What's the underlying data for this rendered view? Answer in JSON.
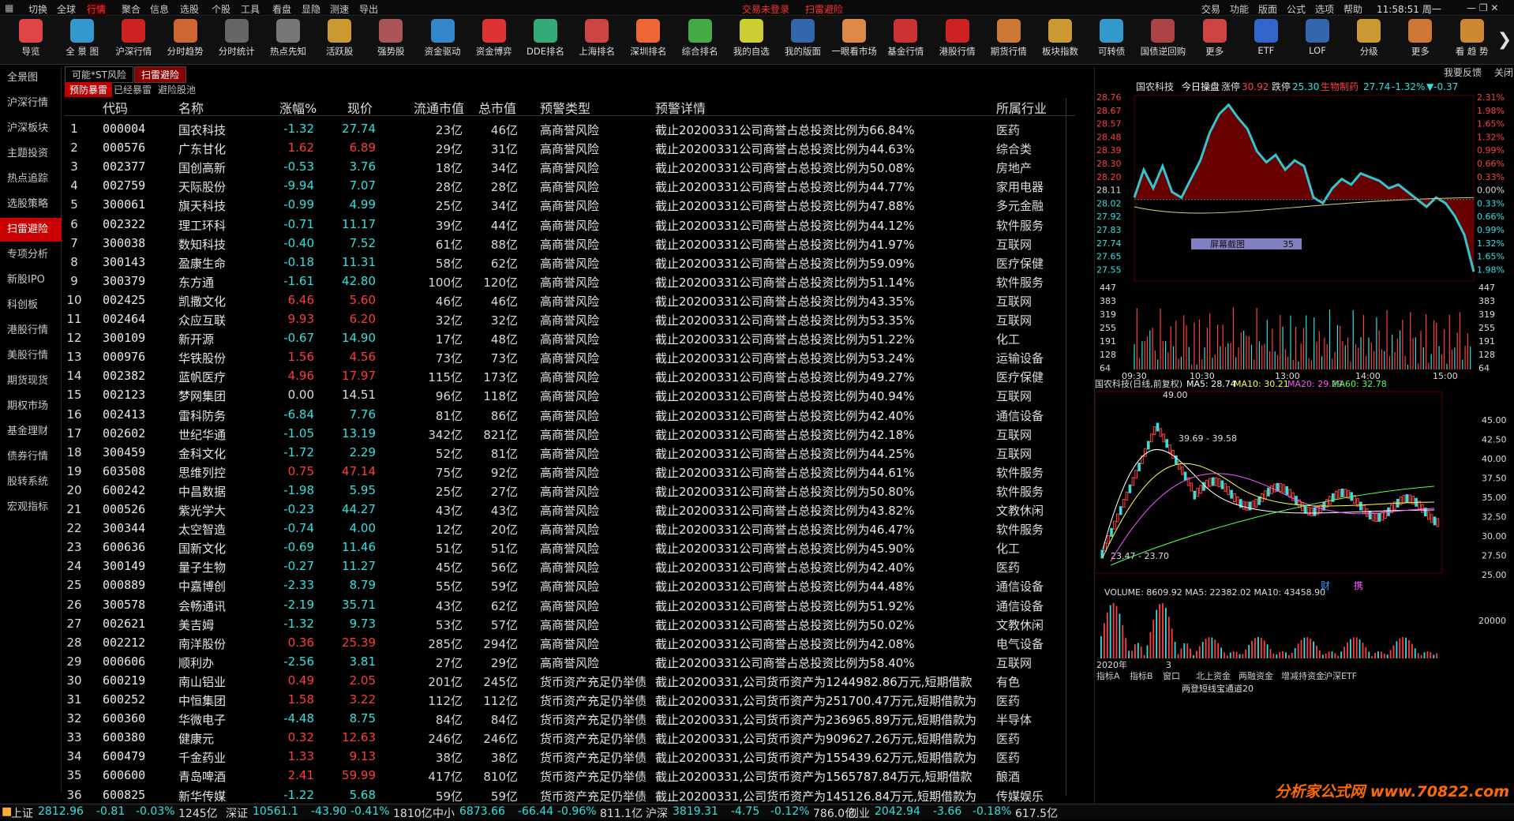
{
  "menubar": {
    "items": [
      "切换",
      "全球",
      "行情",
      "聚合",
      "信息",
      "选股",
      "个股",
      "工具",
      "看盘",
      "显隐",
      "测速",
      "导出"
    ],
    "active": "行情",
    "alerts": [
      "交易未登录",
      "扫雷避险"
    ],
    "right_items": [
      "交易",
      "功能",
      "版面",
      "公式",
      "选项",
      "帮助"
    ],
    "clock": "11:58:51 周一"
  },
  "toolbar": {
    "buttons": [
      "导览",
      "全 景 图",
      "沪深行情",
      "分时趋势",
      "分时统计",
      "热点先知",
      "活跃股",
      "强势股",
      "资金驱动",
      "资金博弈",
      "DDE排名",
      "上海排名",
      "深圳排名",
      "综合排名",
      "我的自选",
      "我的版面",
      "一眼看市场",
      "基金行情",
      "港股行情",
      "期货行情",
      "板块指数",
      "可转债",
      "国债逆回购",
      "更多",
      "ETF",
      "LOF",
      "分级",
      "更多",
      "看 趋 势"
    ]
  },
  "sidebar": {
    "items": [
      "全景图",
      "沪深行情",
      "沪深板块",
      "主题投资",
      "热点追踪",
      "选股策略",
      "扫雷避险",
      "专项分析",
      "新股IPO",
      "科创板",
      "港股行情",
      "美股行情",
      "期货现货",
      "期权市场",
      "基金理财",
      "债券行情",
      "股转系统",
      "宏观指标"
    ],
    "active": "扫雷避险"
  },
  "tabs": {
    "top": [
      "可能*ST风险",
      "扫雷避险"
    ],
    "top_active": "扫雷避险",
    "sub": [
      "预防暴雷",
      "已经暴雷",
      "避险股池"
    ],
    "sub_active": "预防暴雷"
  },
  "table": {
    "headers": [
      "代码",
      "名称",
      "涨幅%",
      "现价",
      "流通市值",
      "总市值",
      "预警类型",
      "预警详情",
      "所属行业"
    ],
    "rows": [
      [
        "1",
        "000004",
        "国农科技",
        "-1.32",
        "27.74",
        "23亿",
        "46亿",
        "高商誉风险",
        "截止20200331公司商誉占总投资比例为66.84%",
        "医药"
      ],
      [
        "2",
        "000576",
        "广东甘化",
        "1.62",
        "6.89",
        "29亿",
        "31亿",
        "高商誉风险",
        "截止20200331公司商誉占总投资比例为44.63%",
        "综合类"
      ],
      [
        "3",
        "002377",
        "国创高新",
        "-0.53",
        "3.76",
        "18亿",
        "34亿",
        "高商誉风险",
        "截止20200331公司商誉占总投资比例为50.08%",
        "房地产"
      ],
      [
        "4",
        "002759",
        "天际股份",
        "-9.94",
        "7.07",
        "28亿",
        "28亿",
        "高商誉风险",
        "截止20200331公司商誉占总投资比例为44.77%",
        "家用电器"
      ],
      [
        "5",
        "300061",
        "旗天科技",
        "-0.99",
        "4.99",
        "25亿",
        "34亿",
        "高商誉风险",
        "截止20200331公司商誉占总投资比例为47.88%",
        "多元金融"
      ],
      [
        "6",
        "002322",
        "理工环科",
        "-0.71",
        "11.17",
        "39亿",
        "44亿",
        "高商誉风险",
        "截止20200331公司商誉占总投资比例为44.12%",
        "软件服务"
      ],
      [
        "7",
        "300038",
        "数知科技",
        "-0.40",
        "7.52",
        "61亿",
        "88亿",
        "高商誉风险",
        "截止20200331公司商誉占总投资比例为41.97%",
        "互联网"
      ],
      [
        "8",
        "300143",
        "盈康生命",
        "-0.18",
        "11.31",
        "58亿",
        "62亿",
        "高商誉风险",
        "截止20200331公司商誉占总投资比例为59.09%",
        "医疗保健"
      ],
      [
        "9",
        "300379",
        "东方通",
        "-1.61",
        "42.80",
        "100亿",
        "120亿",
        "高商誉风险",
        "截止20200331公司商誉占总投资比例为51.14%",
        "软件服务"
      ],
      [
        "10",
        "002425",
        "凯撒文化",
        "6.46",
        "5.60",
        "46亿",
        "46亿",
        "高商誉风险",
        "截止20200331公司商誉占总投资比例为43.35%",
        "互联网"
      ],
      [
        "11",
        "002464",
        "众应互联",
        "9.93",
        "6.20",
        "32亿",
        "32亿",
        "高商誉风险",
        "截止20200331公司商誉占总投资比例为53.35%",
        "互联网"
      ],
      [
        "12",
        "300109",
        "新开源",
        "-0.67",
        "14.90",
        "17亿",
        "48亿",
        "高商誉风险",
        "截止20200331公司商誉占总投资比例为51.22%",
        "化工"
      ],
      [
        "13",
        "000976",
        "华铁股份",
        "1.56",
        "4.56",
        "73亿",
        "73亿",
        "高商誉风险",
        "截止20200331公司商誉占总投资比例为53.24%",
        "运输设备"
      ],
      [
        "14",
        "002382",
        "蓝帆医疗",
        "4.96",
        "17.97",
        "115亿",
        "173亿",
        "高商誉风险",
        "截止20200331公司商誉占总投资比例为49.27%",
        "医疗保健"
      ],
      [
        "15",
        "002123",
        "梦网集团",
        "0.00",
        "14.51",
        "96亿",
        "118亿",
        "高商誉风险",
        "截止20200331公司商誉占总投资比例为40.94%",
        "互联网"
      ],
      [
        "16",
        "002413",
        "雷科防务",
        "-6.84",
        "7.76",
        "81亿",
        "86亿",
        "高商誉风险",
        "截止20200331公司商誉占总投资比例为42.40%",
        "通信设备"
      ],
      [
        "17",
        "002602",
        "世纪华通",
        "-1.05",
        "13.19",
        "342亿",
        "821亿",
        "高商誉风险",
        "截止20200331公司商誉占总投资比例为42.18%",
        "互联网"
      ],
      [
        "18",
        "300459",
        "金科文化",
        "-1.72",
        "2.29",
        "52亿",
        "81亿",
        "高商誉风险",
        "截止20200331公司商誉占总投资比例为44.25%",
        "互联网"
      ],
      [
        "19",
        "603508",
        "思维列控",
        "0.75",
        "47.14",
        "75亿",
        "92亿",
        "高商誉风险",
        "截止20200331公司商誉占总投资比例为44.61%",
        "软件服务"
      ],
      [
        "20",
        "600242",
        "中昌数据",
        "-1.98",
        "5.95",
        "25亿",
        "27亿",
        "高商誉风险",
        "截止20200331公司商誉占总投资比例为50.80%",
        "软件服务"
      ],
      [
        "21",
        "000526",
        "紫光学大",
        "-0.23",
        "44.27",
        "43亿",
        "43亿",
        "高商誉风险",
        "截止20200331公司商誉占总投资比例为43.82%",
        "文教休闲"
      ],
      [
        "22",
        "300344",
        "太空智造",
        "-0.74",
        "4.00",
        "12亿",
        "20亿",
        "高商誉风险",
        "截止20200331公司商誉占总投资比例为46.47%",
        "软件服务"
      ],
      [
        "23",
        "600636",
        "国新文化",
        "-0.69",
        "11.46",
        "51亿",
        "51亿",
        "高商誉风险",
        "截止20200331公司商誉占总投资比例为45.90%",
        "化工"
      ],
      [
        "24",
        "300149",
        "量子生物",
        "-0.27",
        "11.27",
        "45亿",
        "56亿",
        "高商誉风险",
        "截止20200331公司商誉占总投资比例为42.40%",
        "医药"
      ],
      [
        "25",
        "000889",
        "中嘉博创",
        "-2.33",
        "8.79",
        "55亿",
        "59亿",
        "高商誉风险",
        "截止20200331公司商誉占总投资比例为44.48%",
        "通信设备"
      ],
      [
        "26",
        "300578",
        "会畅通讯",
        "-2.19",
        "35.71",
        "43亿",
        "62亿",
        "高商誉风险",
        "截止20200331公司商誉占总投资比例为51.92%",
        "通信设备"
      ],
      [
        "27",
        "002621",
        "美吉姆",
        "-1.32",
        "9.73",
        "53亿",
        "57亿",
        "高商誉风险",
        "截止20200331公司商誉占总投资比例为50.02%",
        "文教休闲"
      ],
      [
        "28",
        "002212",
        "南洋股份",
        "0.36",
        "25.39",
        "285亿",
        "294亿",
        "高商誉风险",
        "截止20200331公司商誉占总投资比例为42.08%",
        "电气设备"
      ],
      [
        "29",
        "000606",
        "顺利办",
        "-2.56",
        "3.81",
        "27亿",
        "29亿",
        "高商誉风险",
        "截止20200331公司商誉占总投资比例为58.40%",
        "互联网"
      ],
      [
        "30",
        "600219",
        "南山铝业",
        "0.49",
        "2.05",
        "201亿",
        "245亿",
        "货币资产充足仍举债",
        "截止20200331,公司货币资产为1244982.86万元,短期借款",
        "有色"
      ],
      [
        "31",
        "600252",
        "中恒集团",
        "1.58",
        "3.22",
        "112亿",
        "112亿",
        "货币资产充足仍举债",
        "截止20200331,公司货币资产为251700.47万元,短期借款为",
        "医药"
      ],
      [
        "32",
        "600360",
        "华微电子",
        "-4.48",
        "8.75",
        "84亿",
        "84亿",
        "货币资产充足仍举债",
        "截止20200331,公司货币资产为236965.89万元,短期借款为",
        "半导体"
      ],
      [
        "33",
        "600380",
        "健康元",
        "0.32",
        "12.63",
        "246亿",
        "246亿",
        "货币资产充足仍举债",
        "截止20200331,公司货币资产为909627.26万元,短期借款为",
        "医药"
      ],
      [
        "34",
        "600479",
        "千金药业",
        "1.33",
        "9.13",
        "38亿",
        "38亿",
        "货币资产充足仍举债",
        "截止20200331,公司货币资产为155439.62万元,短期借款为",
        "医药"
      ],
      [
        "35",
        "600600",
        "青岛啤酒",
        "2.41",
        "59.99",
        "417亿",
        "810亿",
        "货币资产充足仍举债",
        "截止20200331,公司货币资产为1565787.84万元,短期借款",
        "酿酒"
      ],
      [
        "36",
        "600825",
        "新华传媒",
        "-1.22",
        "5.68",
        "59亿",
        "59亿",
        "货币资产充足仍举债",
        "截止20200331,公司货币资产为145126.84万元,短期借款为",
        "传媒娱乐"
      ]
    ]
  },
  "right_panel": {
    "header_right": [
      "我要反馈",
      "关闭"
    ],
    "stock_name": "国农科技",
    "intraday_label": "今日操盘",
    "limit_up_label": "涨停",
    "limit_up": "30.92",
    "limit_down_label": "跌停",
    "limit_down": "25.30",
    "cycle_label": "生物制药",
    "last": "27.74",
    "pct": "-1.32%",
    "chg": "▼-0.37",
    "price_ticks": [
      "28.76",
      "28.67",
      "28.57",
      "28.48",
      "28.39",
      "28.30",
      "28.20",
      "28.11",
      "28.02",
      "27.92",
      "27.83",
      "27.74",
      "27.65",
      "27.55"
    ],
    "pct_ticks": [
      "2.31%",
      "1.98%",
      "1.65%",
      "1.32%",
      "0.99%",
      "0.66%",
      "0.33%",
      "0.00%",
      "0.33%",
      "0.66%",
      "0.99%",
      "1.32%",
      "1.65%",
      "1.98%"
    ],
    "vol_ticks": [
      "447",
      "383",
      "319",
      "255",
      "191",
      "128",
      "64"
    ],
    "time_ticks": [
      "09:30",
      "10:30",
      "13:00",
      "14:00",
      "15:00"
    ],
    "screenshot_tag": "屏幕截图",
    "screenshot_val": "35",
    "kline_title": "国农科技(日线,前复权)",
    "ma_labels": [
      "MA5: 28.74",
      "MA10: 30.21",
      "MA20: 29.29",
      "MA60: 32.78"
    ],
    "ma_colors": [
      "#ffffff",
      "#ffff55",
      "#ff55ff",
      "#55ff55"
    ],
    "kline_ticks": [
      "45.00",
      "42.50",
      "40.00",
      "37.50",
      "35.00",
      "32.50",
      "30.00",
      "27.50",
      "25.00"
    ],
    "kline_high": "49.00",
    "kline_annot": "39.69 - 39.58",
    "kline_low": "23.47 - 23.70",
    "kline_marks": [
      "财",
      "携"
    ],
    "volume_label": "VOLUME: 8609.92  MA5: 22382.02  MA10: 43458.90",
    "volume_tick": "20000",
    "year_label": "2020年",
    "month_label": "3",
    "bottom_tabs": [
      "指标A",
      "指标B",
      "窗口",
      "北上资金",
      "两融资金",
      "增减持资金",
      "沪深ETF"
    ],
    "bottom_note": "两登短线宝通道20"
  },
  "statusbar": {
    "items": [
      {
        "name": "上证",
        "val": "2812.96",
        "chg": "-0.81",
        "pct": "-0.03%",
        "amt": "1245亿"
      },
      {
        "name": "深证",
        "val": "10561.1",
        "chg": "-43.90",
        "pct": "-0.41%",
        "amt": "1810亿"
      },
      {
        "name": "中小",
        "val": "6873.66",
        "chg": "-66.44",
        "pct": "-0.96%",
        "amt": "811.1亿"
      },
      {
        "name": "沪深",
        "val": "3819.31",
        "chg": "-4.75",
        "pct": "-0.12%",
        "amt": "786.0亿"
      },
      {
        "name": "创业",
        "val": "2042.94",
        "chg": "-3.66",
        "pct": "-0.18%",
        "amt": "617.5亿"
      }
    ]
  },
  "watermark": "分析家公式网 www.70822.com"
}
